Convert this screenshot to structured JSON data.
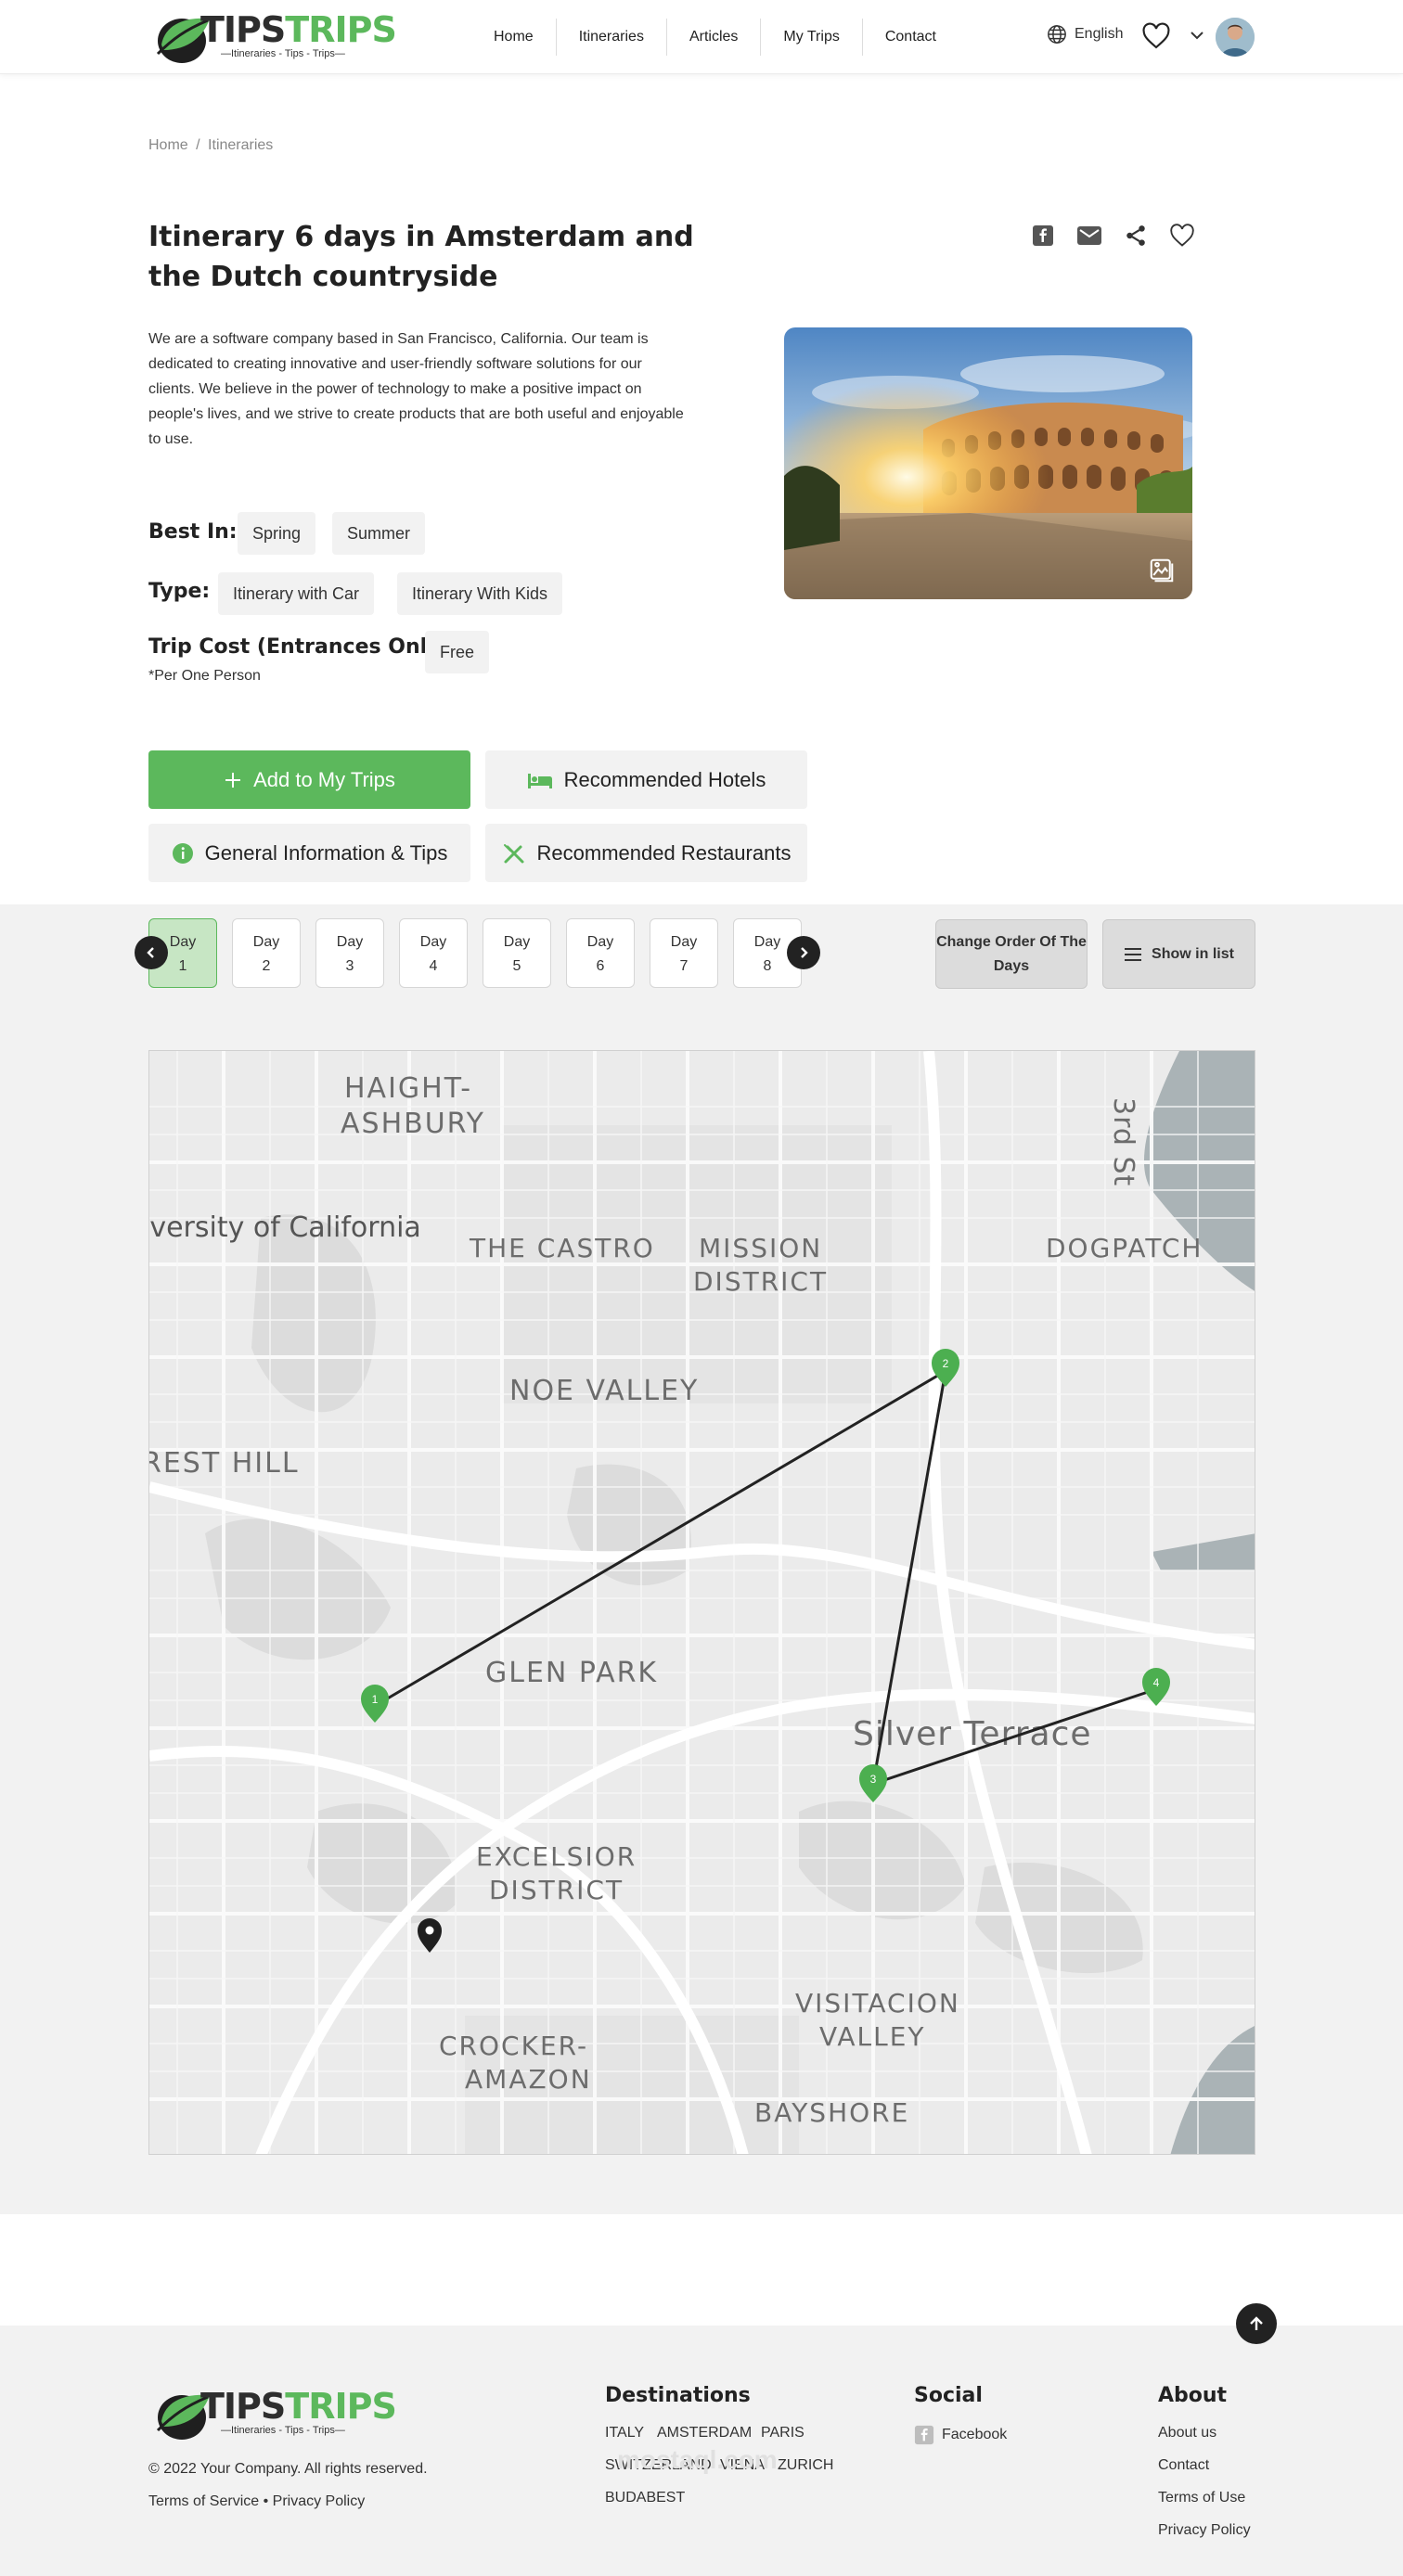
{
  "header": {
    "logo_main": "TIPS",
    "logo_accent": "TRIPS",
    "logo_tagline": "—Itineraries - Tips - Trips—",
    "nav": [
      "Home",
      "Itineraries",
      "Articles",
      "My Trips",
      "Contact"
    ],
    "language": "English"
  },
  "breadcrumb": {
    "home": "Home",
    "separator": "/",
    "current": "Itineraries"
  },
  "itinerary": {
    "title": "Itinerary 6 days in Amsterdam and the Dutch countryside",
    "description": "We are a software company based in San Francisco, California. Our team is dedicated to creating innovative and user-friendly software solutions for our clients. We believe in the power of technology to make a positive impact on people's lives, and we strive to create products that are both useful and enjoyable to use.",
    "best_in_label": "Best In:",
    "best_in": [
      "Spring",
      "Summer"
    ],
    "type_label": "Type:",
    "types": [
      "Itinerary with Car",
      "Itinerary With Kids"
    ],
    "cost_label": "Trip Cost (Entrances Only):",
    "cost_value": "Free",
    "cost_note": "*Per One Person"
  },
  "actions": {
    "add_trip": "Add to My Trips",
    "hotels": "Recommended Hotels",
    "info": "General Information & Tips",
    "restaurants": "Recommended Restaurants"
  },
  "days": {
    "label": "Day",
    "numbers": [
      "1",
      "2",
      "3",
      "4",
      "5",
      "6",
      "7",
      "8"
    ],
    "active": "1",
    "change_order": "Change Order Of The Days",
    "show_list": "Show in list"
  },
  "map": {
    "labels": [
      "HAIGHT-",
      "ASHBURY",
      "iversity of California",
      "THE CASTRO",
      "MISSION",
      "DISTRICT",
      "DOGPATCH",
      "3rd St",
      "NOE VALLEY",
      "REST HILL",
      "GLEN PARK",
      "Silver Terrace",
      "EXCELSIOR",
      "DISTRICT",
      "VISITACION",
      "VALLEY",
      "CROCKER-",
      "AMAZON",
      "BAYSHORE"
    ],
    "markers": [
      "1",
      "2",
      "3",
      "4"
    ],
    "marker_color": "#4caf50"
  },
  "footer": {
    "logo_main": "TIPS",
    "logo_accent": "TRIPS",
    "logo_tagline": "—Itineraries - Tips - Trips—",
    "copyright": "© 2022 Your Company. All rights reserved.",
    "terms": "Terms of Service",
    "dot": "•",
    "privacy": "Privacy Policy",
    "destinations_title": "Destinations",
    "destinations": [
      "ITALY",
      "AMSTERDAM",
      "PARIS",
      "SWITZERLAND",
      "VIENA",
      "ZURICH",
      "BUDABEST"
    ],
    "social_title": "Social",
    "social": [
      "Facebook"
    ],
    "about_title": "About",
    "about": [
      "About us",
      "Contact",
      "Terms of Use",
      "Privacy Policy"
    ],
    "watermark": "mostaql.com"
  },
  "colors": {
    "brand_green": "#5cb85c",
    "dark": "#222222",
    "band": "#f2f2f2"
  }
}
